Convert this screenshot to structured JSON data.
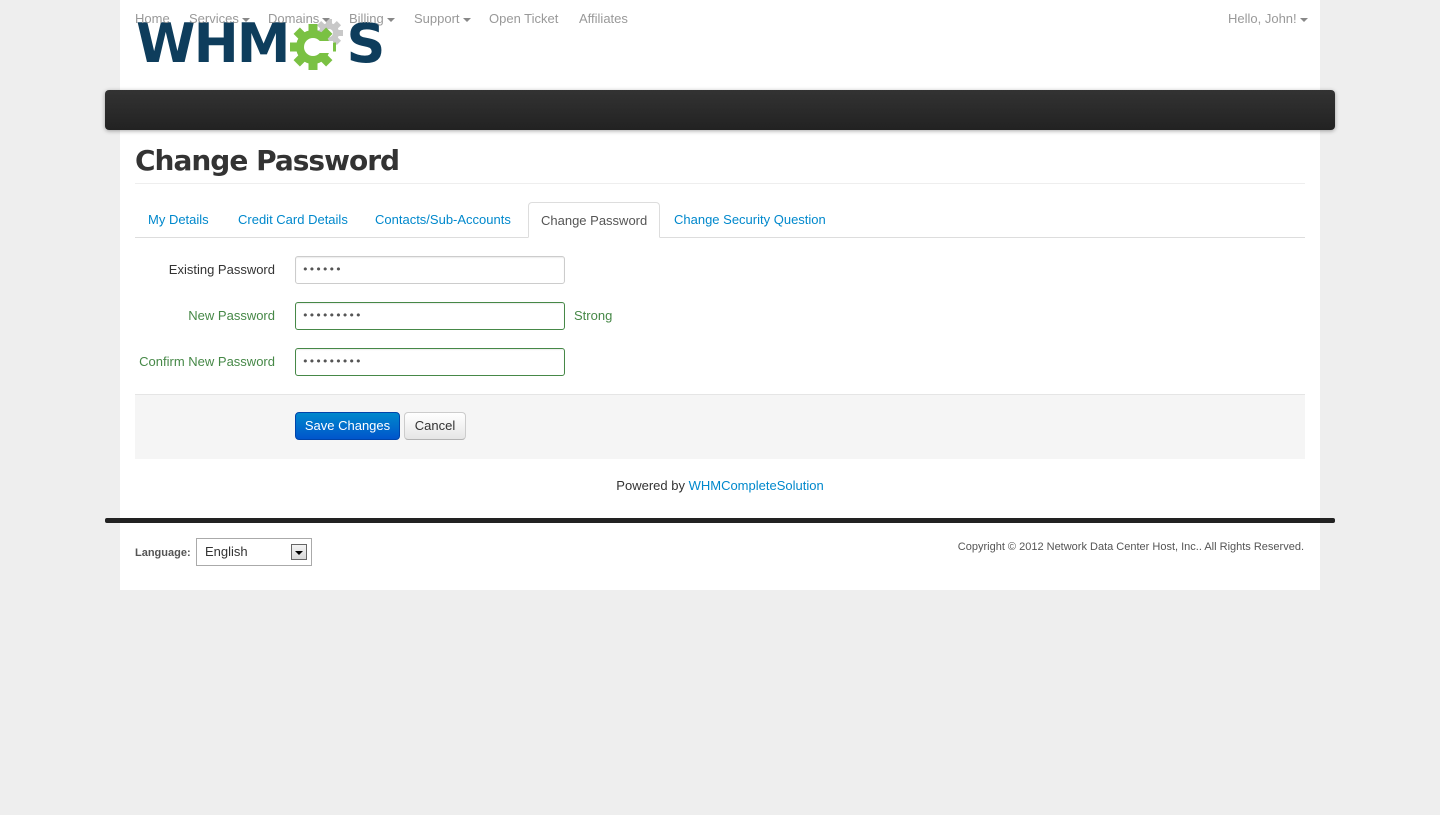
{
  "logo": {
    "text_main": "WHM",
    "text_end": "S",
    "alt": "WHMCS"
  },
  "colors": {
    "logo_blue": "#0e3d5c",
    "logo_green": "#7ac143",
    "link": "#0088cc",
    "success": "#468847",
    "navbar": "#222222",
    "primary_button": "#0066cc"
  },
  "navbar": {
    "items": [
      {
        "label": "Home",
        "dropdown": false
      },
      {
        "label": "Services",
        "dropdown": true
      },
      {
        "label": "Domains",
        "dropdown": true
      },
      {
        "label": "Billing",
        "dropdown": true
      },
      {
        "label": "Support",
        "dropdown": true
      },
      {
        "label": "Open Ticket",
        "dropdown": false
      },
      {
        "label": "Affiliates",
        "dropdown": false
      }
    ],
    "user_menu": "Hello, John!"
  },
  "page_title": "Change Password",
  "tabs": [
    {
      "label": "My Details",
      "active": false
    },
    {
      "label": "Credit Card Details",
      "active": false
    },
    {
      "label": "Contacts/Sub-Accounts",
      "active": false
    },
    {
      "label": "Change Password",
      "active": true
    },
    {
      "label": "Change Security Question",
      "active": false
    }
  ],
  "form": {
    "existing_password": {
      "label": "Existing Password",
      "value": "••••••"
    },
    "new_password": {
      "label": "New Password",
      "value": "•••••••••",
      "strength": "Strong"
    },
    "confirm_password": {
      "label": "Confirm New Password",
      "value": "•••••••••"
    },
    "save_label": "Save Changes",
    "cancel_label": "Cancel"
  },
  "powered_by": {
    "prefix": "Powered by",
    "link": "WHMCompleteSolution"
  },
  "footer": {
    "language_label": "Language:",
    "language_selected": "English",
    "copyright": "Copyright © 2012 Network Data Center Host, Inc.. All Rights Reserved."
  }
}
